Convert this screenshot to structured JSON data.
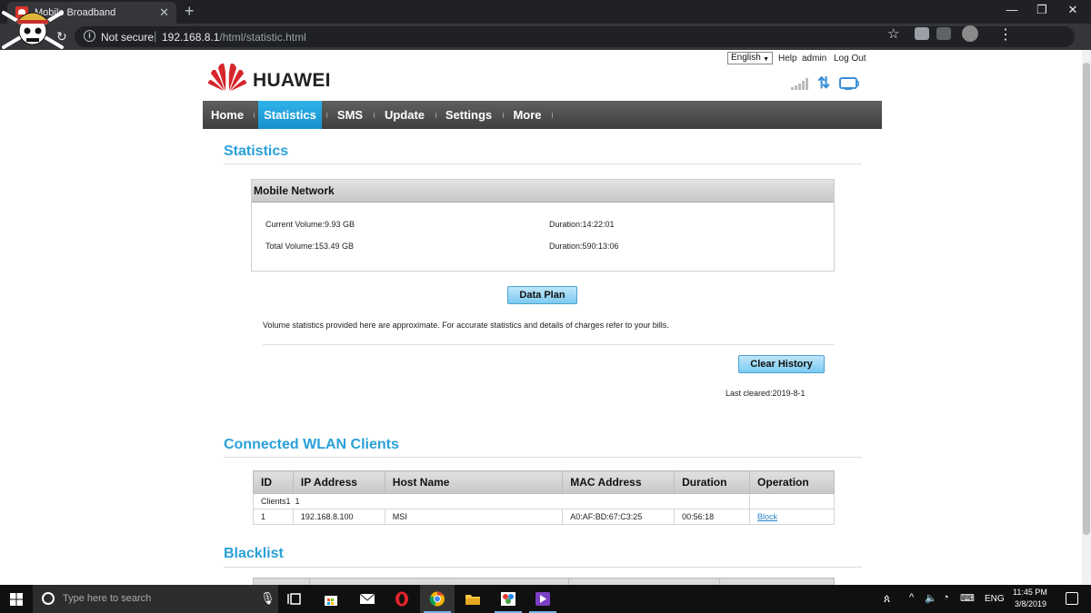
{
  "browser": {
    "tab_title": "Mobile Broadband",
    "security_label": "Not secure",
    "url_host": "192.168.8.1",
    "url_path": "/html/statistic.html"
  },
  "header": {
    "brand": "HUAWEI",
    "language": "English",
    "help": "Help",
    "admin": "admin",
    "logout": "Log Out"
  },
  "nav": {
    "items": [
      "Home",
      "Statistics",
      "SMS",
      "Update",
      "Settings",
      "More"
    ],
    "active": "Statistics"
  },
  "statistics": {
    "title": "Statistics",
    "panel_title": "Mobile Network",
    "current_volume": "Current Volume:9.93 GB",
    "current_duration": "Duration:14:22:01",
    "total_volume": "Total Volume:153.49 GB",
    "total_duration": "Duration:590:13:06",
    "data_plan_button": "Data Plan",
    "disclaimer": "Volume statistics provided here are approximate. For accurate statistics and details of charges refer to your bills.",
    "clear_history_button": "Clear History",
    "last_cleared": "Last cleared:2019-8-1"
  },
  "wlan": {
    "title": "Connected WLAN Clients",
    "headers": [
      "ID",
      "IP Address",
      "Host Name",
      "MAC Address",
      "Duration",
      "Operation"
    ],
    "clients_label": "Clients1",
    "clients_count": "1",
    "rows": [
      {
        "id": "1",
        "ip": "192.168.8.100",
        "host": "MSI",
        "mac": "A0:AF:BD:67:C3:25",
        "duration": "00:56:18",
        "operation": "Block"
      }
    ]
  },
  "blacklist": {
    "title": "Blacklist"
  },
  "taskbar": {
    "search_placeholder": "Type here to search",
    "language": "ENG",
    "time": "11:45 PM",
    "date": "3/8/2019"
  },
  "colors": {
    "accent": "#2aa0d8",
    "nav_active": "#1d9fe0",
    "nav_bar": "#4a4a4a"
  }
}
